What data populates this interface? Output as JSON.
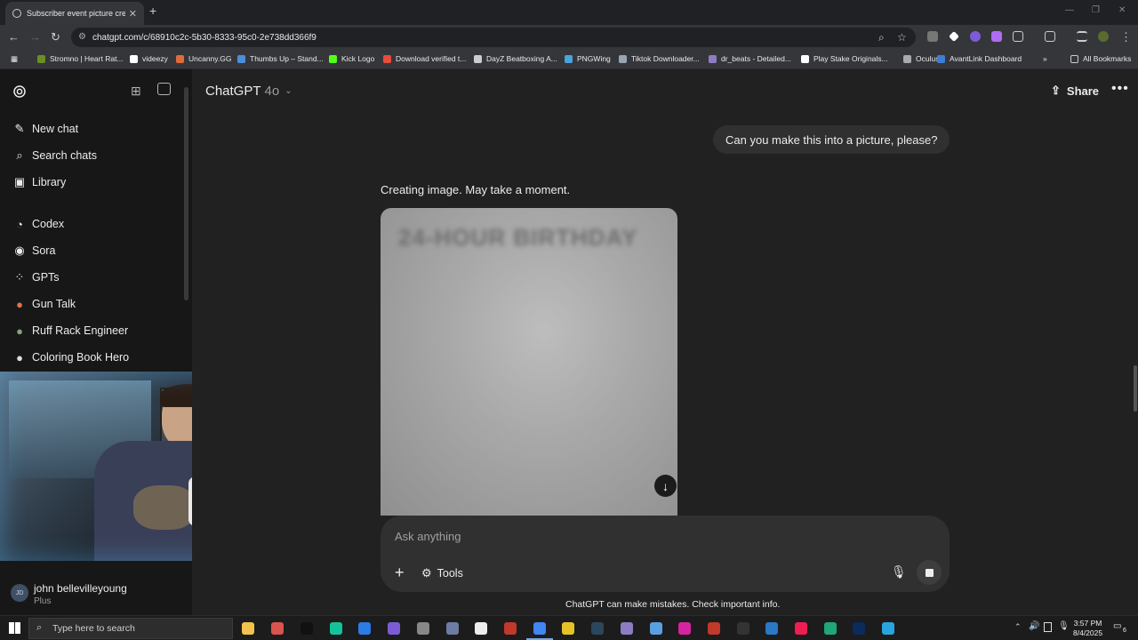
{
  "browser": {
    "tab_title": "Subscriber event picture creati...",
    "url": "chatgpt.com/c/68910c2c-5b30-8333-95c0-2e738dd366f9",
    "bookmarks": [
      {
        "label": "Stromno | Heart Rat...",
        "color": "#6b8e23"
      },
      {
        "label": "videezy",
        "color": "#ffffff"
      },
      {
        "label": "Uncanny.GG",
        "color": "#e06a3a"
      },
      {
        "label": "Thumbs Up – Stand...",
        "color": "#4a90d9"
      },
      {
        "label": "Kick Logo",
        "color": "#53fc18"
      },
      {
        "label": "Download verified t...",
        "color": "#e74c3c"
      },
      {
        "label": "DayZ Beatboxing A...",
        "color": "#cccccc"
      },
      {
        "label": "PNGWing",
        "color": "#4aa3df"
      },
      {
        "label": "Tiktok Downloader...",
        "color": "#9aa5b1"
      },
      {
        "label": "dr_beats - Detailed...",
        "color": "#8e7cc3"
      },
      {
        "label": "Play Stake Originals...",
        "color": "#ffffff"
      },
      {
        "label": "Oculus",
        "color": "#aaaaaa"
      },
      {
        "label": "AvantLink Dashboard",
        "color": "#3b7dd8"
      }
    ],
    "all_bookmarks": "All Bookmarks"
  },
  "sidebar": {
    "items": [
      {
        "label": "New chat",
        "icon": "edit-icon"
      },
      {
        "label": "Search chats",
        "icon": "search-icon"
      },
      {
        "label": "Library",
        "icon": "library-icon"
      },
      {
        "label": "Codex",
        "icon": "codex-icon"
      },
      {
        "label": "Sora",
        "icon": "sora-icon"
      },
      {
        "label": "GPTs",
        "icon": "gpts-icon"
      },
      {
        "label": "Gun Talk",
        "icon": "gpt-avatar-icon"
      },
      {
        "label": "Ruff Rack Engineer",
        "icon": "gpt-avatar-icon"
      },
      {
        "label": "Coloring Book Hero",
        "icon": "gpt-avatar-icon"
      }
    ],
    "user": {
      "name": "john bellevilleyoung",
      "plan": "Plus",
      "initials": "JD"
    }
  },
  "main": {
    "model_name": "ChatGPT",
    "model_version": "4o",
    "share_label": "Share",
    "user_message": "Can you make this into a picture, please?",
    "status_text": "Creating image. May take a moment.",
    "image_blur_text": "24-HOUR BIRTHDAY",
    "composer": {
      "placeholder": "Ask anything",
      "tools_label": "Tools"
    },
    "disclaimer": "ChatGPT can make mistakes. Check important info."
  },
  "taskbar": {
    "search_placeholder": "Type here to search",
    "time": "3:57 PM",
    "date": "8/4/2025",
    "notifications": "6"
  }
}
